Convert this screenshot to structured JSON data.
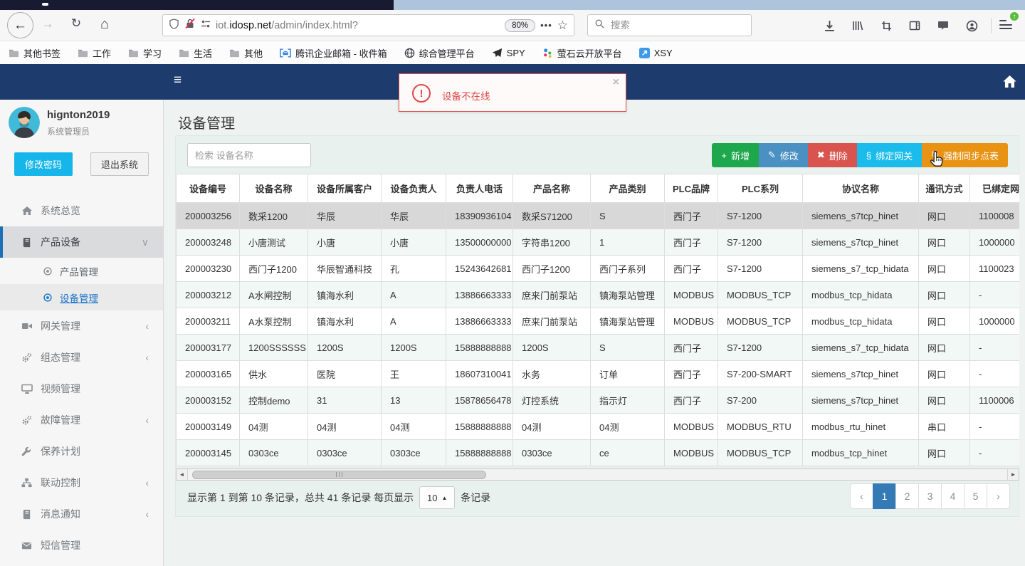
{
  "browser": {
    "url": {
      "prefix": "iot.",
      "domain": "idosp.net",
      "path": "/admin/index.html?"
    },
    "zoom_badge": "80%",
    "search_placeholder": "搜索",
    "bookmarks": [
      {
        "icon": "folder",
        "label": "其他书签"
      },
      {
        "icon": "folder",
        "label": "工作"
      },
      {
        "icon": "folder",
        "label": "学习"
      },
      {
        "icon": "folder",
        "label": "生活"
      },
      {
        "icon": "folder",
        "label": "其他"
      },
      {
        "icon": "tencent-mail",
        "label": "腾讯企业邮箱 - 收件箱"
      },
      {
        "icon": "globe",
        "label": "综合管理平台"
      },
      {
        "icon": "plane",
        "label": "SPY"
      },
      {
        "icon": "ys-cloud",
        "label": "萤石云开放平台"
      },
      {
        "icon": "xsy",
        "label": "XSY"
      }
    ]
  },
  "alert": {
    "text": "设备不在线"
  },
  "sidebar": {
    "username": "hignton2019",
    "role": "系统管理员",
    "change_password": "修改密码",
    "logout": "退出系统",
    "menu": [
      {
        "icon": "home",
        "label": "系统总览"
      },
      {
        "icon": "book",
        "label": "产品设备",
        "expanded": true,
        "active": true,
        "children": [
          {
            "label": "产品管理",
            "active": false
          },
          {
            "label": "设备管理",
            "active": true
          }
        ]
      },
      {
        "icon": "gateway",
        "label": "网关管理",
        "collapsible": true
      },
      {
        "icon": "gears",
        "label": "组态管理",
        "collapsible": true
      },
      {
        "icon": "monitor",
        "label": "视频管理"
      },
      {
        "icon": "gears",
        "label": "故障管理",
        "collapsible": true
      },
      {
        "icon": "wrench",
        "label": "保养计划"
      },
      {
        "icon": "sitemap",
        "label": "联动控制",
        "collapsible": true
      },
      {
        "icon": "book",
        "label": "消息通知",
        "collapsible": true
      },
      {
        "icon": "envelope",
        "label": "短信管理"
      }
    ]
  },
  "page": {
    "title": "设备管理",
    "search_placeholder": "检索 设备名称",
    "toolbar": [
      {
        "icon": "plus",
        "label": "新增",
        "color": "#1fa74e"
      },
      {
        "icon": "pencil",
        "label": "修改",
        "color": "#4a90c3"
      },
      {
        "icon": "cross",
        "label": "删除",
        "color": "#d9534f"
      },
      {
        "icon": "link",
        "label": "绑定网关",
        "color": "#1bbceb"
      },
      {
        "icon": "sync",
        "label": "强制同步点表",
        "color": "#e89313"
      }
    ],
    "table": {
      "headers": [
        "设备编号",
        "设备名称",
        "设备所属客户",
        "设备负责人",
        "负责人电话",
        "产品名称",
        "产品类别",
        "PLC品牌",
        "PLC系列",
        "协议名称",
        "通讯方式",
        "已绑定网关"
      ],
      "selected_row_index": 0,
      "rows": [
        [
          "200003256",
          "数采1200",
          "华辰",
          "华辰",
          "18390936104",
          "数采S71200",
          "S",
          "西门子",
          "S7-1200",
          "siemens_s7tcp_hinet",
          "网口",
          "1100008"
        ],
        [
          "200003248",
          "小唐测试",
          "小唐",
          "小唐",
          "13500000000",
          "字符串1200",
          "1",
          "西门子",
          "S7-1200",
          "siemens_s7tcp_hinet",
          "网口",
          "1000000"
        ],
        [
          "200003230",
          "西门子1200",
          "华辰智通科技",
          "孔",
          "15243642681",
          "西门子1200",
          "西门子系列",
          "西门子",
          "S7-1200",
          "siemens_s7_tcp_hidata",
          "网口",
          "1100023"
        ],
        [
          "200003212",
          "A水闸控制",
          "镇海水利",
          "A",
          "13886663333",
          "庶来门前泵站",
          "镇海泵站管理",
          "MODBUS",
          "MODBUS_TCP",
          "modbus_tcp_hidata",
          "网口",
          "-"
        ],
        [
          "200003211",
          "A水泵控制",
          "镇海水利",
          "A",
          "13886663333",
          "庶来门前泵站",
          "镇海泵站管理",
          "MODBUS",
          "MODBUS_TCP",
          "modbus_tcp_hidata",
          "网口",
          "1000000"
        ],
        [
          "200003177",
          "1200SSSSSS",
          "1200S",
          "1200S",
          "15888888888",
          "1200S",
          "S",
          "西门子",
          "S7-1200",
          "siemens_s7_tcp_hidata",
          "网口",
          "-"
        ],
        [
          "200003165",
          "供水",
          "医院",
          "王",
          "18607310041",
          "水务",
          "订单",
          "西门子",
          "S7-200-SMART",
          "siemens_s7tcp_hinet",
          "网口",
          "-"
        ],
        [
          "200003152",
          "控制demo",
          "31",
          "13",
          "15878656478",
          "灯控系统",
          "指示灯",
          "西门子",
          "S7-200",
          "siemens_s7tcp_hinet",
          "网口",
          "1100006"
        ],
        [
          "200003149",
          "04测",
          "04测",
          "04测",
          "15888888888",
          "04测",
          "04测",
          "MODBUS",
          "MODBUS_RTU",
          "modbus_rtu_hinet",
          "串口",
          "-"
        ],
        [
          "200003145",
          "0303ce",
          "0303ce",
          "0303ce",
          "15888888888",
          "0303ce",
          "ce",
          "MODBUS",
          "MODBUS_TCP",
          "modbus_tcp_hinet",
          "网口",
          "-"
        ]
      ]
    },
    "footer": {
      "info_before": "显示第 1 到第 10 条记录，总共 41 条记录 每页显示",
      "page_size": "10",
      "info_after": "条记录",
      "pagination": [
        "‹",
        "1",
        "2",
        "3",
        "4",
        "5",
        "›"
      ],
      "active_page": "1"
    }
  },
  "icons": {
    "back": "←",
    "forward": "→",
    "reload": "↻",
    "home": "⌂",
    "dots": "•••",
    "star": "☆",
    "up_arrow": "↑",
    "hamburger": "≡",
    "close": "×",
    "bang": "!",
    "plus": "+",
    "pencil": "✎",
    "cross": "✖",
    "link": "§",
    "sync": "↻",
    "chevron_down": "∨",
    "chevron_left": "‹",
    "scroll_left": "◄",
    "scroll_right": "►",
    "caret_up": "▲"
  },
  "colors": {
    "navbar": "#1e3b6d",
    "alert_red": "#e04848",
    "active_page_blue": "#337ab7",
    "sidebar_link_blue": "#1a73c8",
    "change_password_cyan": "#17b6ea"
  }
}
